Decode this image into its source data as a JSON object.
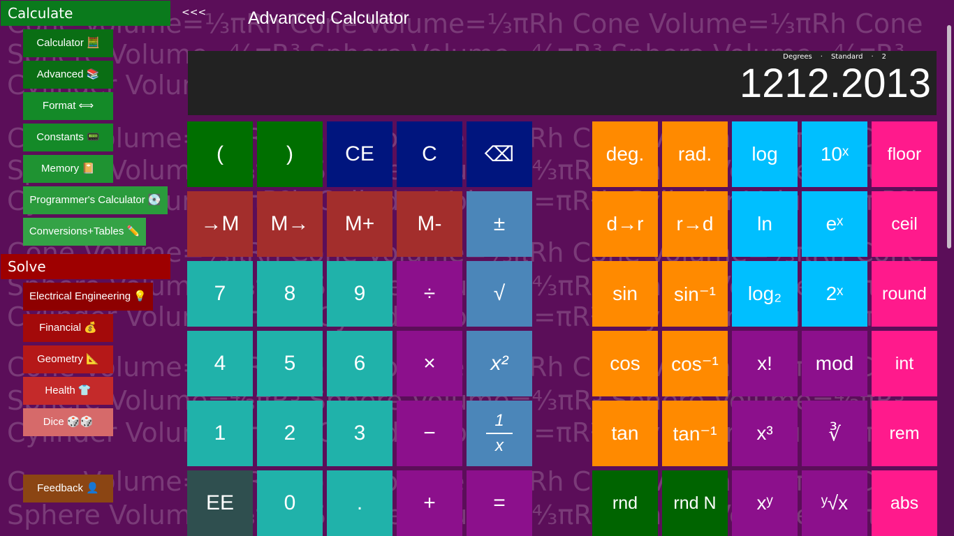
{
  "background_text": [
    "Cone Volume=⅓πRh     Cone Volume=⅓πRh     Cone Volume=⅓πRh     Cone",
    "Sphere Volume=⁴⁄₃πR³   Sphere Volume=⁴⁄₃πR³   Sphere Volume=⁴⁄₃πR³",
    "Cylinder Volume=πR²h    Cylinder Volume=πR²h    Cylinder Volume=πR²h"
  ],
  "app": {
    "title": "Advanced Calculator",
    "back_label": "<<<"
  },
  "sidebar": {
    "calculate_header": "Calculate",
    "calculate_items": [
      {
        "label": "Calculator 🧮"
      },
      {
        "label": "Advanced 📚"
      },
      {
        "label": "Format ⟺"
      },
      {
        "label": "Constants 📟"
      },
      {
        "label": "Memory 📔"
      },
      {
        "label": "Programmer's Calculator 💽"
      },
      {
        "label": "Conversions+Tables ✏️"
      }
    ],
    "solve_header": "Solve",
    "solve_items": [
      {
        "label": "Electrical Engineering 💡"
      },
      {
        "label": "Financial 💰"
      },
      {
        "label": "Geometry 📐"
      },
      {
        "label": "Health 👕"
      },
      {
        "label": "Dice 🎲🎲"
      }
    ],
    "feedback_label": "Feedback 👤"
  },
  "display": {
    "angle_mode": "Degrees",
    "separator": "·",
    "number_format": "Standard",
    "precision": "2",
    "value": "1212.2013"
  },
  "keys": {
    "left": [
      [
        "(",
        ")",
        "CE",
        "C",
        "⌫"
      ],
      [
        "→M",
        "M→",
        "M+",
        "M-",
        "±"
      ],
      [
        "7",
        "8",
        "9",
        "÷",
        "√"
      ],
      [
        "4",
        "5",
        "6",
        "×",
        "x²"
      ],
      [
        "1",
        "2",
        "3",
        "−",
        "1/x"
      ],
      [
        "EE",
        "0",
        ".",
        "+",
        "="
      ]
    ],
    "right": [
      [
        "deg.",
        "rad.",
        "log",
        "10ˣ",
        "floor"
      ],
      [
        "d→r",
        "r→d",
        "ln",
        "eˣ",
        "ceil"
      ],
      [
        "sin",
        "sin⁻¹",
        "log₂",
        "2ˣ",
        "round"
      ],
      [
        "cos",
        "cos⁻¹",
        "x!",
        "mod",
        "int"
      ],
      [
        "tan",
        "tan⁻¹",
        "x³",
        "∛",
        "rem"
      ],
      [
        "rnd",
        "rnd N",
        "xʸ",
        "ʸ√x",
        "abs"
      ]
    ],
    "frac_num": "1",
    "frac_den": "x"
  },
  "colors": {
    "background": "#5b0e59",
    "calculate_header": "#0a7a1c",
    "solve_header": "#9e0000",
    "green": "#006f00",
    "navy": "#00157e",
    "memory_red": "#a32e2c",
    "steel_blue": "#4b86b9",
    "teal": "#20b2aa",
    "purple": "#8c108c",
    "slate": "#2f4f4f",
    "orange": "#ff8a00",
    "sky": "#00bfff",
    "pink": "#ff1a8c",
    "dark_green": "#006400"
  }
}
